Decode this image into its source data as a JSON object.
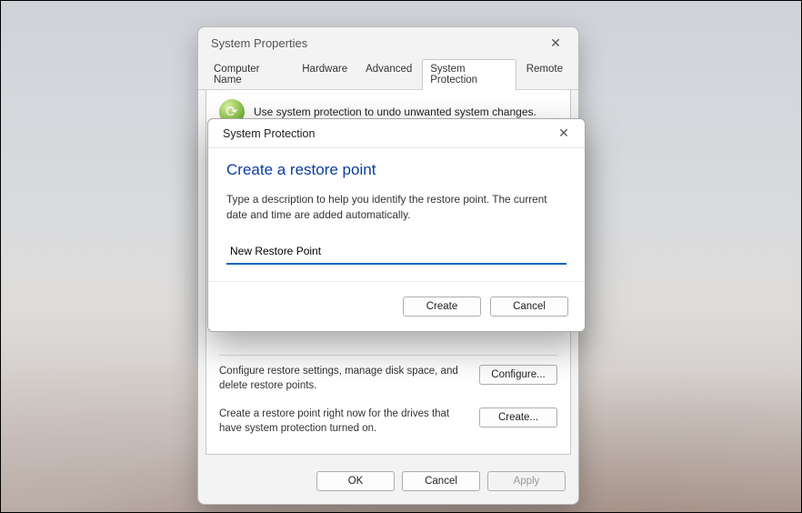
{
  "sysprops": {
    "title": "System Properties",
    "tabs": [
      {
        "label": "Computer Name"
      },
      {
        "label": "Hardware"
      },
      {
        "label": "Advanced"
      },
      {
        "label": "System Protection"
      },
      {
        "label": "Remote"
      }
    ],
    "intro_text": "Use system protection to undo unwanted system changes.",
    "configure": {
      "desc": "Configure restore settings, manage disk space, and delete restore points.",
      "button": "Configure..."
    },
    "create": {
      "desc": "Create a restore point right now for the drives that have system protection turned on.",
      "button": "Create..."
    },
    "footer": {
      "ok": "OK",
      "cancel": "Cancel",
      "apply": "Apply"
    }
  },
  "modal": {
    "title": "System Protection",
    "heading": "Create a restore point",
    "instructions": "Type a description to help you identify the restore point. The current date and time are added automatically.",
    "input_value": "New Restore Point",
    "create": "Create",
    "cancel": "Cancel"
  }
}
